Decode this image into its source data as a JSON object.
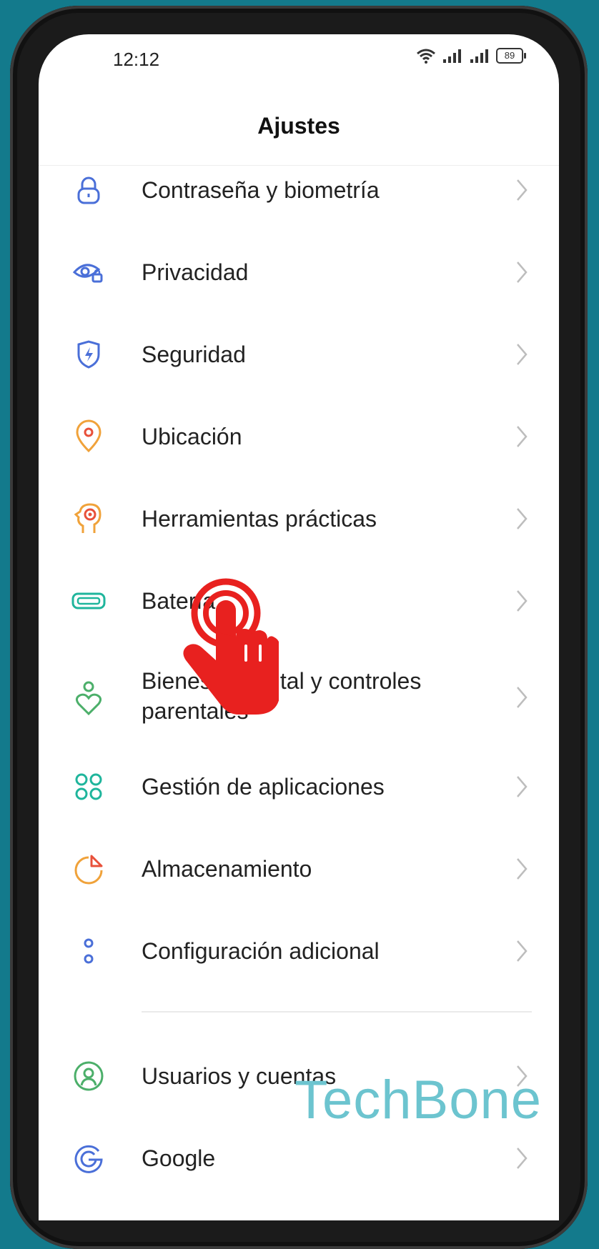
{
  "status_bar": {
    "time": "12:12",
    "battery": "89"
  },
  "header": {
    "title": "Ajustes"
  },
  "settings_items": [
    {
      "label": "Contraseña y biometría",
      "icon": "lock-icon"
    },
    {
      "label": "Privacidad",
      "icon": "privacy-eye-icon"
    },
    {
      "label": "Seguridad",
      "icon": "shield-icon"
    },
    {
      "label": "Ubicación",
      "icon": "location-pin-icon"
    },
    {
      "label": "Herramientas prácticas",
      "icon": "tools-head-icon"
    },
    {
      "label": "Batería",
      "icon": "battery-icon"
    },
    {
      "label": "Bienestar digital y controles parentales",
      "icon": "wellbeing-icon"
    },
    {
      "label": "Gestión de aplicaciones",
      "icon": "apps-icon"
    },
    {
      "label": "Almacenamiento",
      "icon": "storage-pie-icon"
    },
    {
      "label": "Configuración adicional",
      "icon": "additional-settings-icon"
    },
    {
      "label": "Usuarios y cuentas",
      "icon": "user-icon"
    },
    {
      "label": "Google",
      "icon": "google-icon"
    }
  ],
  "watermark": "TechBone",
  "colors": {
    "background": "#137a8c",
    "tap_indicator": "#e8211f",
    "watermark": "#6cc4cf"
  }
}
